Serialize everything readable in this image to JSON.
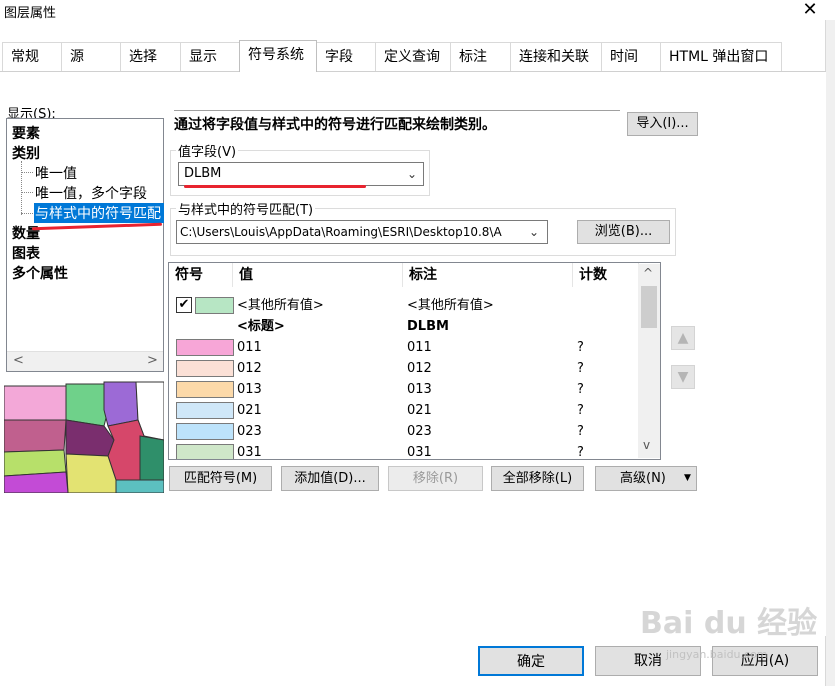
{
  "window": {
    "title": "图层属性",
    "close": "✕"
  },
  "tabs": [
    "常规",
    "源",
    "选择",
    "显示",
    "符号系统",
    "字段",
    "定义查询",
    "标注",
    "连接和关联",
    "时间",
    "HTML 弹出窗口"
  ],
  "show_label": "显示(S):",
  "tree": {
    "items": [
      {
        "label": "要素",
        "bold": true
      },
      {
        "label": "类别",
        "bold": true
      },
      {
        "label": "唯一值",
        "bold": false
      },
      {
        "label": "唯一值，多个字段",
        "bold": false
      },
      {
        "label": "与样式中的符号匹配",
        "bold": false,
        "selected": true
      },
      {
        "label": "数量",
        "bold": true
      },
      {
        "label": "图表",
        "bold": true
      },
      {
        "label": "多个属性",
        "bold": true
      }
    ]
  },
  "description": "通过将字段值与样式中的符号进行匹配来绘制类别。",
  "import_button": "导入(I)...",
  "value_field": {
    "label": "值字段(V)",
    "value": "DLBM"
  },
  "style_match": {
    "label": "与样式中的符号匹配(T)",
    "value": "C:\\Users\\Louis\\AppData\\Roaming\\ESRI\\Desktop10.8\\A",
    "browse": "浏览(B)..."
  },
  "grid": {
    "headers": [
      "符号",
      "值",
      "标注",
      "计数"
    ],
    "other_row": {
      "value": "<其他所有值>",
      "label": "<其他所有值>",
      "color": "#b7e6c4",
      "checked": true
    },
    "heading_row": {
      "value": "<标题>",
      "label": "DLBM"
    },
    "rows": [
      {
        "value": "011",
        "label": "011",
        "count": "?",
        "color": "#f7a6d7"
      },
      {
        "value": "012",
        "label": "012",
        "count": "?",
        "color": "#fbe0d6"
      },
      {
        "value": "013",
        "label": "013",
        "count": "?",
        "color": "#fcd9a9"
      },
      {
        "value": "021",
        "label": "021",
        "count": "?",
        "color": "#cfe7f8"
      },
      {
        "value": "023",
        "label": "023",
        "count": "?",
        "color": "#bde3fb"
      },
      {
        "value": "031",
        "label": "031",
        "count": "?",
        "color": "#cfe7c9"
      }
    ]
  },
  "action_buttons": {
    "match": "匹配符号(M)",
    "add": "添加值(D)...",
    "remove": "移除(R)",
    "remove_all": "全部移除(L)",
    "advanced": "高级(N)"
  },
  "footer": {
    "ok": "确定",
    "cancel": "取消",
    "apply": "应用(A)"
  },
  "watermark": {
    "main": "Bai du 经验",
    "sub": "jingyan.baidu.com"
  },
  "scroll": {
    "left": "<",
    "right": ">",
    "up": "^",
    "down": "v"
  }
}
